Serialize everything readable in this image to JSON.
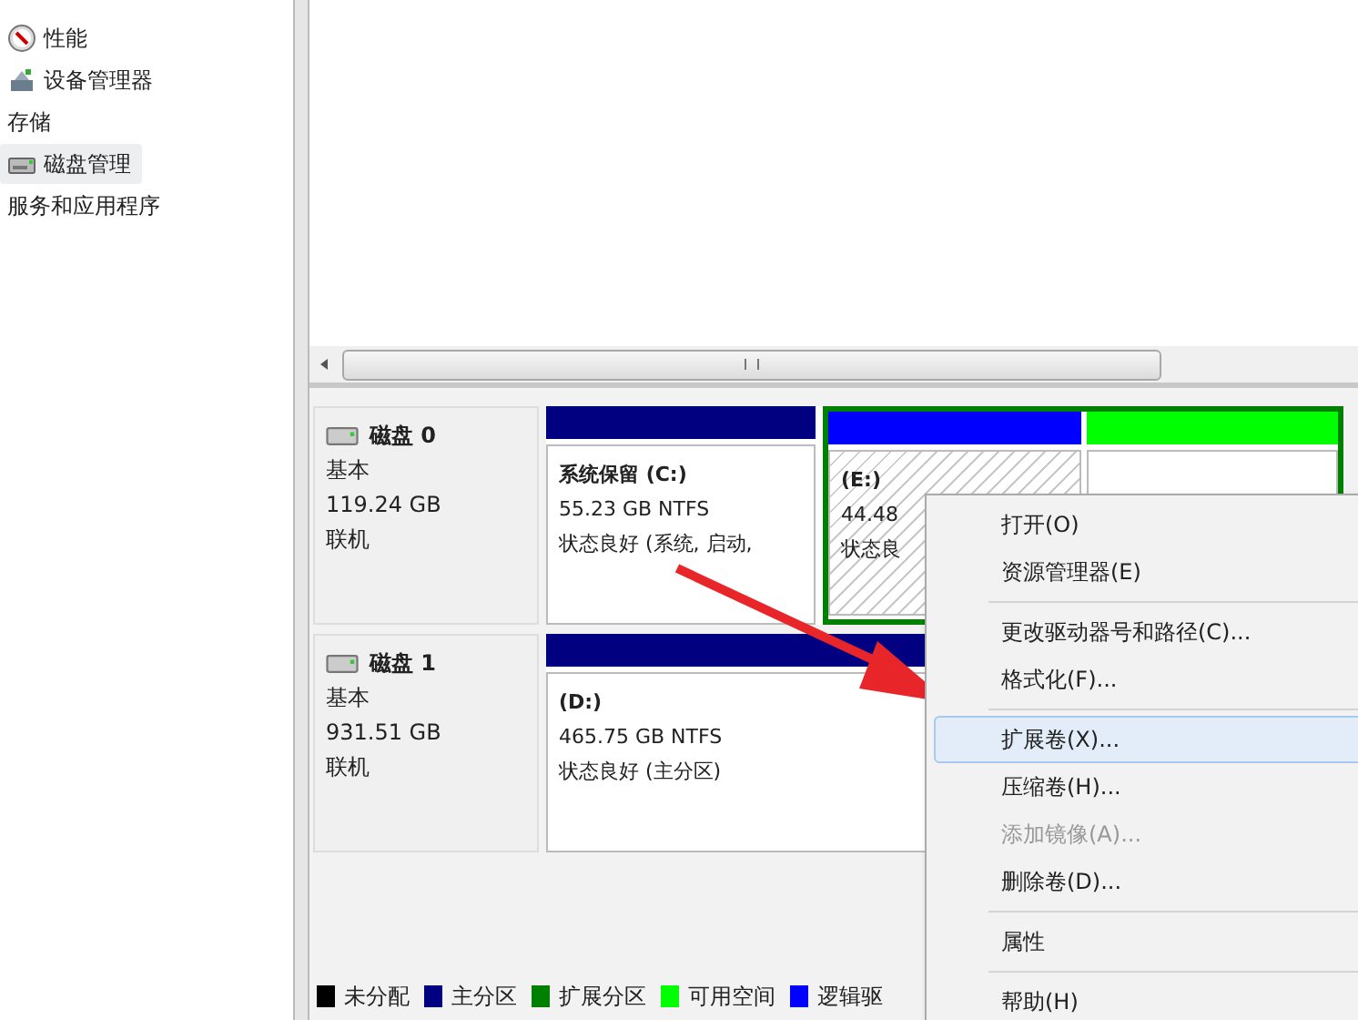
{
  "sidebar": {
    "items": [
      {
        "label": "性能",
        "kind": "perf",
        "selected": false
      },
      {
        "label": "设备管理器",
        "kind": "device",
        "selected": false
      },
      {
        "label": "存储",
        "kind": "header",
        "selected": false
      },
      {
        "label": "磁盘管理",
        "kind": "disk",
        "selected": true
      },
      {
        "label": "服务和应用程序",
        "kind": "header",
        "selected": false
      }
    ]
  },
  "disks": [
    {
      "name": "磁盘 0",
      "type": "基本",
      "size": "119.24 GB",
      "status": "联机",
      "partitions": [
        {
          "kind": "primary",
          "color": "#000080",
          "title": "系统保留  (C:)",
          "detail": "55.23 GB NTFS",
          "state": "状态良好 (系统, 启动,",
          "selected": false
        },
        {
          "kind": "extended",
          "color": "#008000",
          "partitions": [
            {
              "kind": "logical",
              "color": "#0000ff",
              "title": "(E:)",
              "detail": "44.48",
              "state": "状态良",
              "selected": true
            },
            {
              "kind": "free",
              "color": "#00ff00",
              "selected": false
            }
          ]
        }
      ]
    },
    {
      "name": "磁盘 1",
      "type": "基本",
      "size": "931.51 GB",
      "status": "联机",
      "partitions": [
        {
          "kind": "primary",
          "color": "#000080",
          "title": "(D:)",
          "detail": "465.75 GB NTFS",
          "state": "状态良好 (主分区)",
          "selected": false
        }
      ]
    }
  ],
  "legend": [
    {
      "label": "未分配",
      "color": "#000000"
    },
    {
      "label": "主分区",
      "color": "#000080"
    },
    {
      "label": "扩展分区",
      "color": "#008000"
    },
    {
      "label": "可用空间",
      "color": "#00ff00"
    },
    {
      "label": "逻辑驱",
      "color": "#0000ff"
    }
  ],
  "context_menu": {
    "groups": [
      [
        {
          "label": "打开(O)",
          "selected": false,
          "disabled": false
        },
        {
          "label": "资源管理器(E)",
          "selected": false,
          "disabled": false
        }
      ],
      [
        {
          "label": "更改驱动器号和路径(C)...",
          "selected": false,
          "disabled": false
        },
        {
          "label": "格式化(F)...",
          "selected": false,
          "disabled": false
        }
      ],
      [
        {
          "label": "扩展卷(X)...",
          "selected": true,
          "disabled": false
        },
        {
          "label": "压缩卷(H)...",
          "selected": false,
          "disabled": false
        },
        {
          "label": "添加镜像(A)...",
          "selected": false,
          "disabled": true
        },
        {
          "label": "删除卷(D)...",
          "selected": false,
          "disabled": false
        }
      ],
      [
        {
          "label": "属性",
          "selected": false,
          "disabled": false
        }
      ],
      [
        {
          "label": "帮助(H)",
          "selected": false,
          "disabled": false
        }
      ]
    ]
  }
}
